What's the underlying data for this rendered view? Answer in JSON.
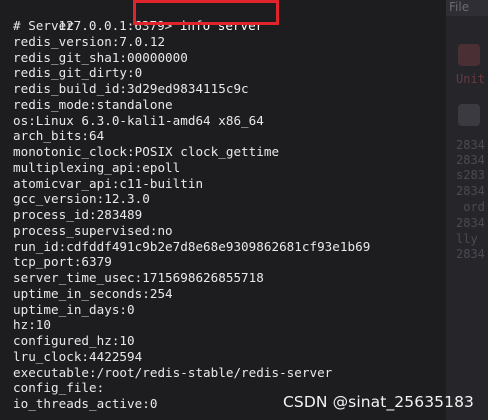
{
  "terminal": {
    "prompt": "127.0.0.1:6379>",
    "command": "info server",
    "output": [
      "# Server",
      "redis_version:7.0.12",
      "redis_git_sha1:00000000",
      "redis_git_dirty:0",
      "redis_build_id:3d29ed9834115c9c",
      "redis_mode:standalone",
      "os:Linux 6.3.0-kali1-amd64 x86_64",
      "arch_bits:64",
      "monotonic_clock:POSIX clock_gettime",
      "multiplexing_api:epoll",
      "atomicvar_api:c11-builtin",
      "gcc_version:12.3.0",
      "process_id:283489",
      "process_supervised:no",
      "run_id:cdfddf491c9b2e7d8e68e9309862681cf93e1b69",
      "tcp_port:6379",
      "server_time_usec:1715698626855718",
      "uptime_in_seconds:254",
      "uptime_in_days:0",
      "hz:10",
      "configured_hz:10",
      "lru_clock:4422594",
      "executable:/root/redis-stable/redis-server",
      "config_file:",
      "io_threads_active:0"
    ]
  },
  "background_window": {
    "menu_label": "File",
    "fragments": [
      "Unit",
      "2834",
      "2834",
      "s283",
      "2834",
      " ord",
      "2834",
      "lly",
      "2834"
    ]
  },
  "watermark": "CSDN @sinat_25635183",
  "colors": {
    "terminal_bg": "#1d1d20",
    "text": "#e9e9e9",
    "highlight": "#e0242c"
  }
}
